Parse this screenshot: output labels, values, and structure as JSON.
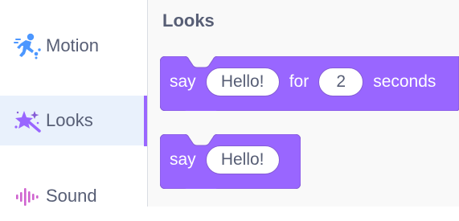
{
  "colors": {
    "looks_block": "#9966ff",
    "looks_block_border": "#855cd6",
    "selected_category_bg": "#e9f1fc",
    "text_gray": "#575e75",
    "motion_icon": "#4c97ff",
    "sound_icon": "#cf63cf"
  },
  "sidebar": {
    "categories": [
      {
        "label": "Motion",
        "icon": "motion-icon"
      },
      {
        "label": "Looks",
        "icon": "looks-icon",
        "selected": true
      },
      {
        "label": "Sound",
        "icon": "sound-icon"
      }
    ]
  },
  "flyout": {
    "section_title": "Looks",
    "blocks": [
      {
        "parts": [
          {
            "type": "text",
            "value": "say"
          },
          {
            "type": "input",
            "value": "Hello!"
          },
          {
            "type": "text",
            "value": "for"
          },
          {
            "type": "input",
            "value": "2"
          },
          {
            "type": "text",
            "value": "seconds"
          }
        ]
      },
      {
        "parts": [
          {
            "type": "text",
            "value": "say"
          },
          {
            "type": "input",
            "value": "Hello!"
          }
        ]
      }
    ]
  }
}
